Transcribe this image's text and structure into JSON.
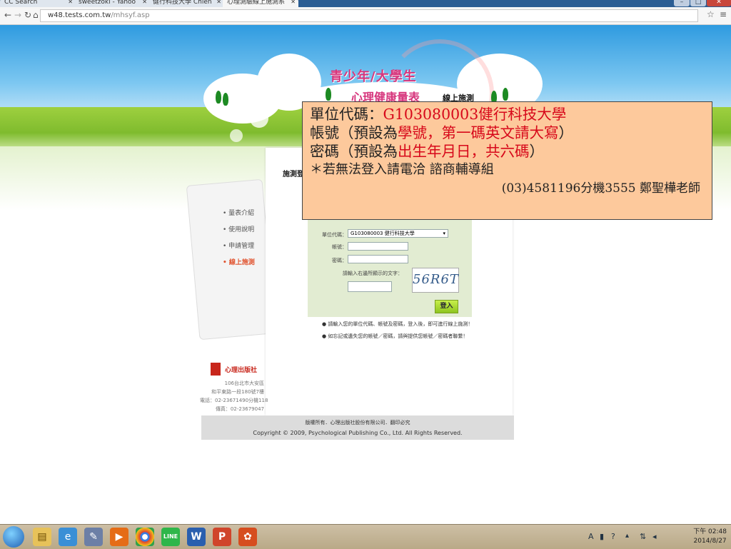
{
  "browser": {
    "tabs": [
      {
        "label": "CC Search"
      },
      {
        "label": "sweetzoki - Yahoo"
      },
      {
        "label": "健行科技大學 Chien"
      },
      {
        "label": "心理測驗線上施測系"
      }
    ],
    "url_host": "w48.tests.com.tw",
    "url_path": "/mhsyf.asp"
  },
  "header": {
    "title": "青少年/大學生",
    "subtitle": "心理健康量表",
    "subtitle2": "線上施測"
  },
  "nav": {
    "items": [
      {
        "label": "量表介紹"
      },
      {
        "label": "使用說明"
      },
      {
        "label": "申請管理"
      },
      {
        "label": "線上施測"
      }
    ]
  },
  "main": {
    "section_title": "施測登入"
  },
  "login": {
    "unit_label": "單位代碼：",
    "unit_value": "G103080003 健行科技大學",
    "account_label": "帳號：",
    "password_label": "密碼：",
    "captcha_label": "請輸入右邊所顯示的文字：",
    "captcha_text": "56R6T",
    "submit_label": "登入"
  },
  "notes": [
    "請輸入您的單位代碼、帳號及密碼，登入後，即可進行線上施測！",
    "如忘記或遺失您的帳號／密碼，請與提供您帳號／密碼者聯繫！"
  ],
  "publisher": {
    "name": "心理出版社",
    "lines": [
      "106台北市大安區",
      "和平東路一段180號7樓",
      "電話：02-23671490分機118",
      "傳真：02-23679047"
    ]
  },
  "footer": {
    "line1": "版權所有．心理出版社股份有限公司．翻印必究",
    "line2": "Copyright © 2009, Psychological Publishing Co., Ltd. All Rights Reserved."
  },
  "callout": {
    "l1a": "單位代碼：",
    "l1b": "G103080003健行科技大學",
    "l2a": "帳號（預設為",
    "l2b": "學號，第一碼英文請大寫",
    "l2c": "）",
    "l3a": "密碼（預設為",
    "l3b": "出生年月日，共六碼",
    "l3c": "）",
    "l4": "＊若無法登入請電洽  諮商輔導組",
    "l5": "(03)4581196分機3555 鄭聖樺老師"
  },
  "clock": {
    "time": "下午 02:48",
    "date": "2014/8/27"
  },
  "colors": {
    "callout_bg": "#fdc99c",
    "highlight": "#d7081a",
    "title_pink": "#d6357c"
  }
}
